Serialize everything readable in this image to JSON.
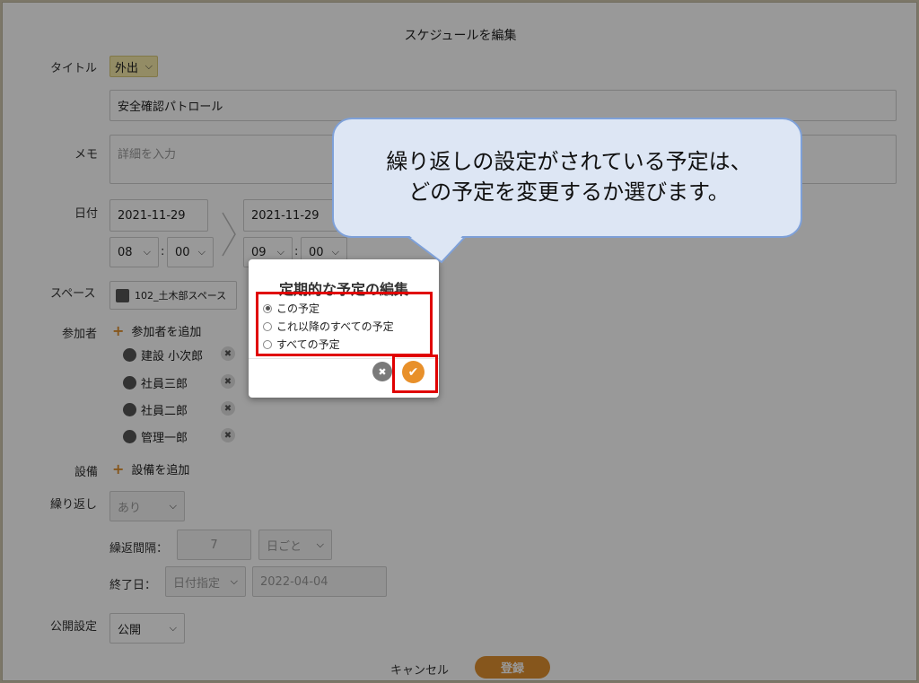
{
  "dialog_header": "スケジュールを編集",
  "fields": {
    "title_label": "タイトル",
    "title_category": "外出",
    "title_value": "安全確認パトロール",
    "memo_label": "メモ",
    "memo_placeholder": "詳細を入力",
    "date_label": "日付",
    "start_date": "2021-11-29",
    "start_hour": "08",
    "start_min": "00",
    "end_date": "2021-11-29",
    "end_hour": "09",
    "end_min": "00",
    "time_sep": ":",
    "space_label": "スペース",
    "space_value": "102_土木部スペース",
    "participants_label": "参加者",
    "add_participant": "参加者を追加",
    "participants": [
      "建設 小次郎",
      "社員三郎",
      "社員二郎",
      "管理一郎"
    ],
    "equipment_label": "設備",
    "add_equipment": "設備を追加",
    "repeat_label": "繰り返し",
    "repeat_value": "あり",
    "interval_label": "繰返間隔：",
    "interval_value": "7",
    "interval_unit": "日ごと",
    "end_label": "終了日：",
    "end_mode": "日付指定",
    "end_value": "2022-04-04",
    "public_label": "公開設定",
    "public_value": "公開",
    "cancel": "キャンセル",
    "submit": "登録"
  },
  "recurring_dialog": {
    "title": "定期的な予定の編集",
    "options": [
      "この予定",
      "これ以降のすべての予定",
      "すべての予定"
    ],
    "selected_index": 0
  },
  "callout": {
    "line1": "繰り返しの設定がされている予定は、",
    "line2": "どの予定を変更するか選びます。"
  },
  "colors": {
    "accent": "#e09030",
    "highlight": "#e00000",
    "callout_fill": "#dde6f4",
    "callout_border": "#7ea0d8"
  }
}
